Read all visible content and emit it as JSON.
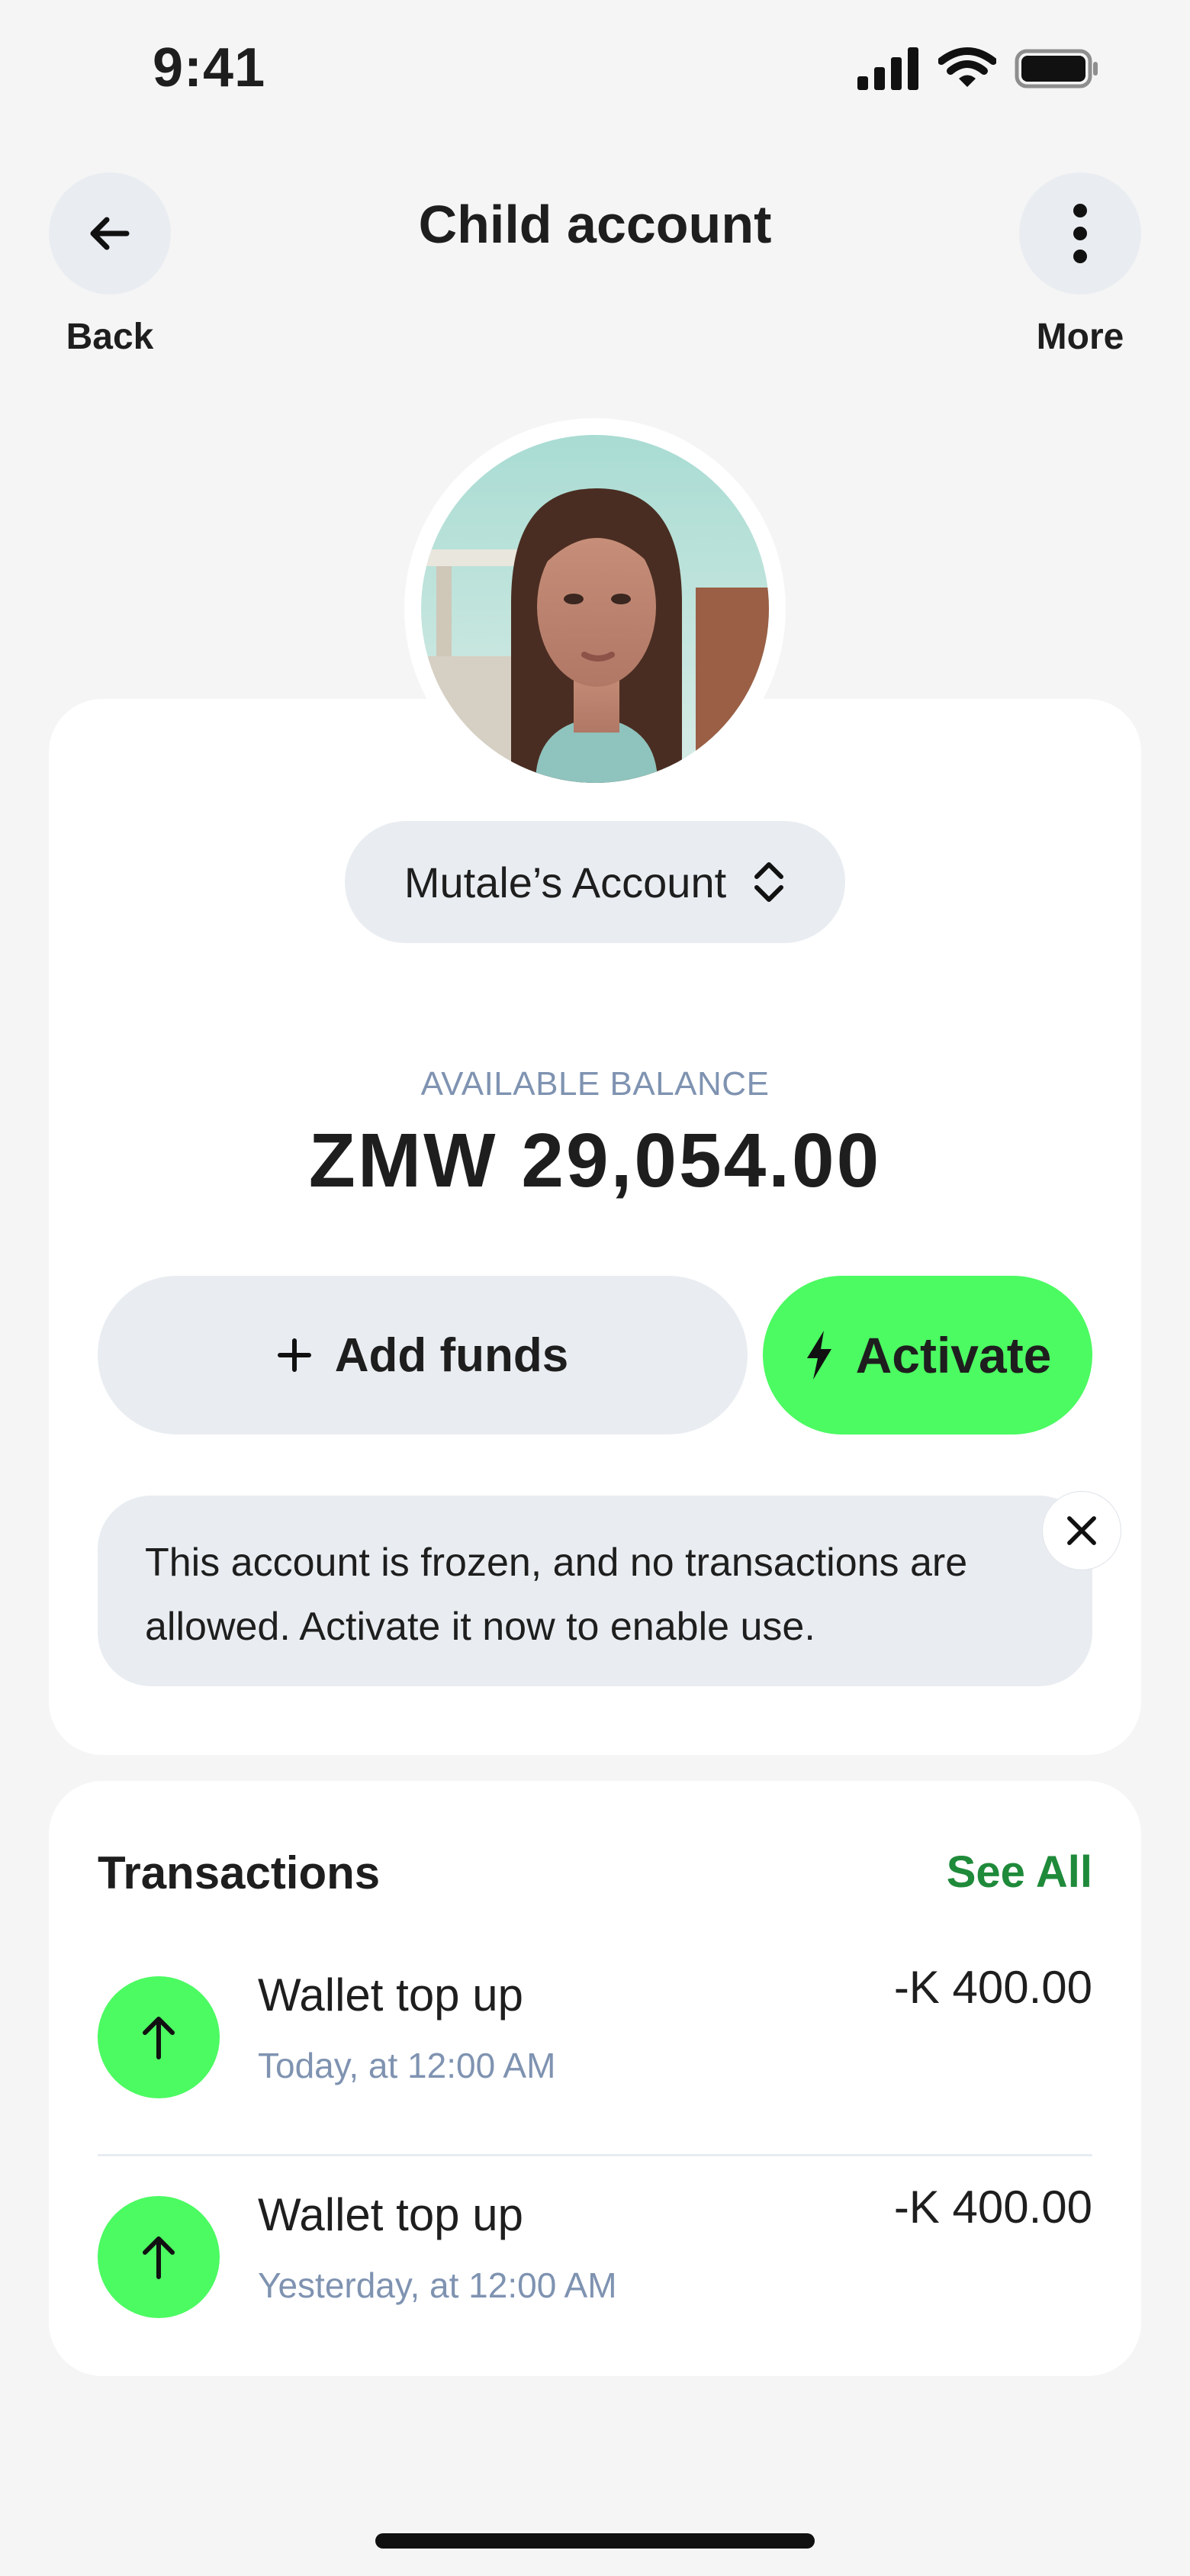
{
  "status_bar": {
    "time": "9:41",
    "icons": [
      "signal-icon",
      "wifi-icon",
      "battery-icon"
    ]
  },
  "header": {
    "title": "Child account",
    "back_label": "Back",
    "more_label": "More"
  },
  "account": {
    "name": "Mutale’s Account",
    "balance_label": "AVAILABLE BALANCE",
    "balance": "ZMW 29,054.00"
  },
  "actions": {
    "add_funds": "Add funds",
    "activate": "Activate"
  },
  "notice": {
    "text": "This account is frozen, and no transactions are allowed. Activate it now to enable use."
  },
  "transactions": {
    "title": "Transactions",
    "see_all": "See All",
    "items": [
      {
        "name": "Wallet top up",
        "date": "Today, at 12:00 AM",
        "amount": "-K 400.00"
      },
      {
        "name": "Wallet top up",
        "date": "Yesterday, at 12:00 AM",
        "amount": "-K 400.00"
      }
    ]
  },
  "colors": {
    "accent_green": "#4cfa62",
    "link_green": "#1f8a3a",
    "muted_text": "#7f93b1",
    "pill_bg": "#e9edf1",
    "page_bg": "#f5f5f5"
  }
}
